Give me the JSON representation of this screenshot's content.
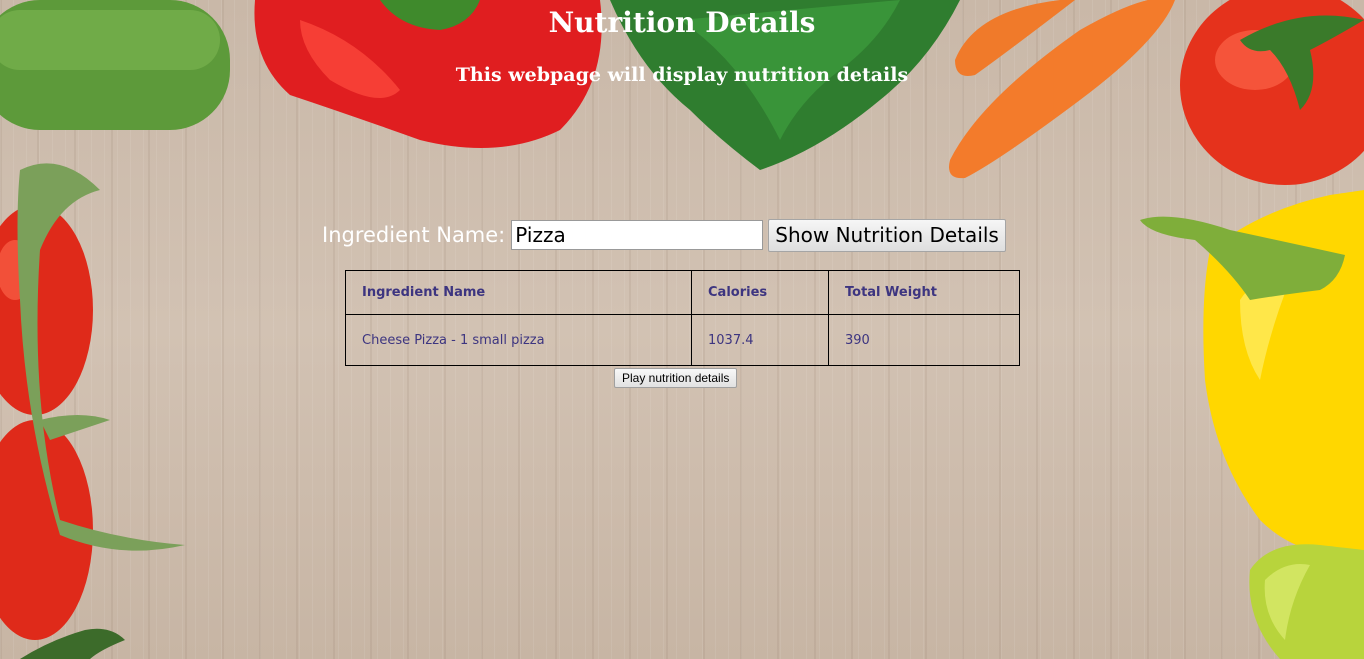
{
  "header": {
    "title": "Nutrition Details",
    "subtitle": "This webpage will display nutrition details"
  },
  "search": {
    "label": "Ingredient Name:",
    "value": "Pizza",
    "button_label": "Show Nutrition Details"
  },
  "table": {
    "headers": [
      "Ingredient Name",
      "Calories",
      "Total Weight"
    ],
    "rows": [
      [
        "Cheese Pizza - 1 small pizza",
        "1037.4",
        "390"
      ]
    ]
  },
  "play_button_label": "Play nutrition details",
  "colors": {
    "table_text": "#3d3580",
    "heading_text": "#ffffff"
  }
}
